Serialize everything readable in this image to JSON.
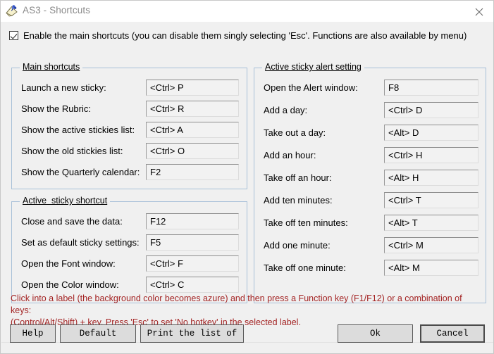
{
  "window": {
    "title": "AS3 - Shortcuts",
    "icon": "sticky-note-pin-icon",
    "close_label": "✕",
    "accent_border": "#a8c0d8",
    "hint_color": "#a32323",
    "background": "#f0f0f0"
  },
  "enable": {
    "checked": true,
    "label": "Enable the main shortcuts (you can disable them singly selecting 'Esc'. Functions are also available by menu)"
  },
  "groups": [
    {
      "id": "main-shortcuts",
      "title": "Main shortcuts",
      "rows": [
        {
          "label": "Launch a new sticky:",
          "value": "<Ctrl> P"
        },
        {
          "label": "Show the Rubric:",
          "value": "<Ctrl> R"
        },
        {
          "label": "Show the active stickies list:",
          "value": "<Ctrl> A"
        },
        {
          "label": "Show the old stickies list:",
          "value": "<Ctrl> O"
        },
        {
          "label": "Show the Quarterly calendar:",
          "value": "F2"
        }
      ]
    },
    {
      "id": "active-sticky-shortcut",
      "title": "Active  sticky shortcut",
      "rows": [
        {
          "label": "Close and save the data:",
          "value": "F12"
        },
        {
          "label": "Set as default sticky settings:",
          "value": "F5"
        },
        {
          "label": "Open the Font window:",
          "value": "<Ctrl> F"
        },
        {
          "label": "Open the Color window:",
          "value": "<Ctrl> C"
        }
      ]
    },
    {
      "id": "active-sticky-alert-setting",
      "title": "Active sticky alert setting",
      "rows": [
        {
          "label": "Open the Alert window:",
          "value": "F8"
        },
        {
          "label": "Add a day:",
          "value": "<Ctrl> D"
        },
        {
          "label": "Take out a day:",
          "value": "<Alt> D"
        },
        {
          "label": "Add an hour:",
          "value": "<Ctrl> H"
        },
        {
          "label": "Take off an hour:",
          "value": "<Alt> H"
        },
        {
          "label": "Add ten minutes:",
          "value": "<Ctrl> T"
        },
        {
          "label": "Take off ten minutes:",
          "value": "<Alt> T"
        },
        {
          "label": "Add one minute:",
          "value": "<Ctrl> M"
        },
        {
          "label": "Take off one minute:",
          "value": "<Alt> M"
        }
      ]
    }
  ],
  "hint": "Click into a label (the background color becomes azure) and then press a Function key (F1/F12) or a combination of keys:\n(Control/Alt/Shift) + key.  Press 'Esc' to set 'No hotkey' in the selected label.",
  "buttons": {
    "help": "Help",
    "default": "Default",
    "print": "Print the list of",
    "ok": "Ok",
    "cancel": "Cancel"
  }
}
